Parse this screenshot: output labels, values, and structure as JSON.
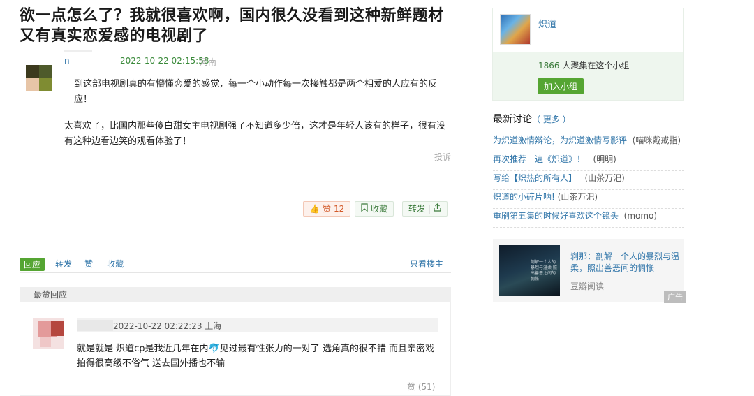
{
  "post": {
    "title": "欲一点怎么了？我就很喜欢啊，国内很久没看到这种新鲜题材又有真实恋爱感的电视剧了",
    "author_name": "n",
    "time": "2022-10-22 02:15:58",
    "location": "河南",
    "paragraphs": [
      "到这部电视剧真的有懵懂恋爱的感觉，每一个小动作每一次接触都是两个相爱的人应有的反应！",
      "太喜欢了，比国内那些傻白甜女主电视剧强了不知道多少倍，这才是年轻人该有的样子，很有没有这种边看边笑的观看体验了！"
    ],
    "report_label": "投诉",
    "like_label": "赞",
    "like_count": "12",
    "favorite_label": "收藏",
    "share_label": "转发"
  },
  "reply_bar": {
    "reply_label": "回应",
    "forward_label": "转发",
    "like_label": "赞",
    "collect_label": "收藏",
    "only_op_label": "只看楼主"
  },
  "top_replies": {
    "header": "最赞回应",
    "items": [
      {
        "time_location": "2022-10-22 02:22:23 上海",
        "text": "就是就是 炽道cp是我近几年在内🐬见过最有性张力的一对了 选角真的很不错 而且亲密戏拍得很高级不俗气 送去国外播也不输",
        "vote_label": "赞 (51)"
      }
    ]
  },
  "group": {
    "name": "炽道",
    "count": "1866",
    "count_suffix": "人聚集在这个小组",
    "join_label": "加入小组"
  },
  "latest": {
    "title": "最新讨论",
    "more_label": "（ 更多 ）",
    "items": [
      {
        "title": "为炽道激情辩论，为炽道激情写影评",
        "user": "(喵咪戴戒指)"
      },
      {
        "title": "再次推荐一遍《炽道》！",
        "user": "(明明)"
      },
      {
        "title": "写给【炽热的所有人】",
        "user": "(山茶万汜)"
      },
      {
        "title": "炽道的小碎片呐!",
        "user": "(山茶万汜)"
      },
      {
        "title": "重刷第五集的时候好喜欢这个镜头",
        "user": "(momo)"
      }
    ]
  },
  "ad": {
    "title": "刹那：剖解一个人的暴烈与温柔，照出善恶间的惆怅",
    "source": "豆瓣阅读",
    "tag": "广告",
    "cover_text": "剖解一个人的暴烈与温柔 照出善恶之间的惆怅"
  },
  "colors": {
    "link": "#3377aa",
    "green": "#55a532",
    "like_red": "#d25a2a"
  }
}
